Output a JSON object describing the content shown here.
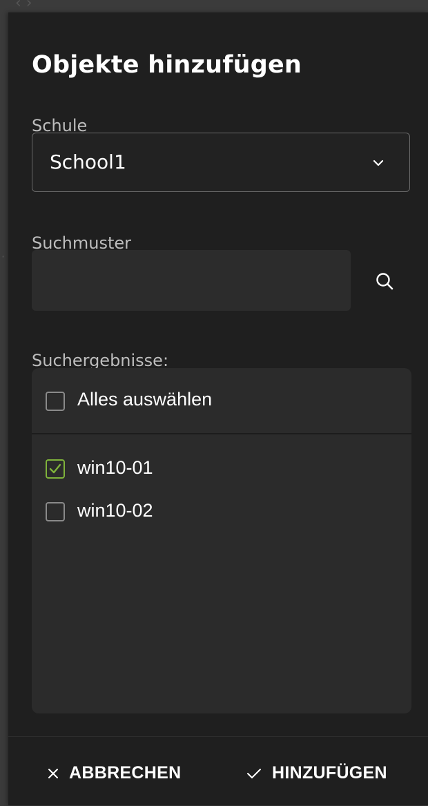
{
  "dialog": {
    "title": "Objekte hinzufügen"
  },
  "school": {
    "label": "Schule",
    "selected": "School1"
  },
  "search": {
    "label": "Suchmuster",
    "value": "",
    "placeholder": ""
  },
  "results": {
    "label": "Suchergebnisse:",
    "select_all_label": "Alles auswählen",
    "select_all_checked": false,
    "items": [
      {
        "label": "win10-01",
        "checked": true
      },
      {
        "label": "win10-02",
        "checked": false
      }
    ]
  },
  "footer": {
    "cancel_label": "ABBRECHEN",
    "add_label": "HINZUFÜGEN"
  },
  "colors": {
    "dialog_bg": "#1f1f1f",
    "accent_check": "#7fb33b",
    "text": "#ffffff",
    "muted_text": "#bdbdbd"
  },
  "icons": {
    "select_chevron": "chevron-down-icon",
    "search": "search-icon",
    "cancel": "close-icon",
    "add": "check-icon"
  }
}
